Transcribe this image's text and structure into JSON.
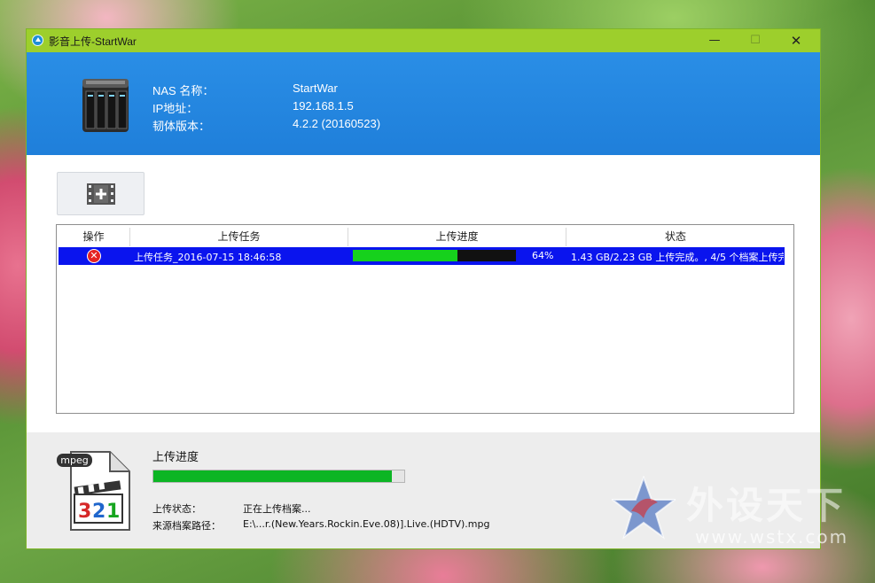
{
  "window": {
    "title": "影音上传-StartWar",
    "controls": {
      "minimize": "—",
      "maximize": "☐",
      "close": "✕"
    }
  },
  "header": {
    "labels": [
      "NAS 名称：",
      "IP地址：",
      "韧体版本："
    ],
    "values": [
      "StartWar",
      "192.168.1.5",
      "4.2.2 (20160523)"
    ]
  },
  "toolbar": {
    "add_button_icon": "film-add-icon"
  },
  "table": {
    "columns": [
      "操作",
      "上传任务",
      "上传进度",
      "状态"
    ],
    "rows": [
      {
        "action_icon": "cancel-icon",
        "task": "上传任务_2016-07-15 18:46:58",
        "progress": 64,
        "progress_label": "64%",
        "status": "1.43 GB/2.23 GB 上传完成。, 4/5 个档案上传完"
      }
    ],
    "selection_color": "#0a14ee"
  },
  "footer": {
    "file_badge": "mpeg",
    "file_digits": "321",
    "progress_title": "上传进度",
    "progress": 0.95,
    "status_label": "上传状态：",
    "status_value": "正在上传档案...",
    "source_label": "来源档案路径：",
    "source_value": "E:\\...r.(New.Years.Rockin.Eve.08)].Live.(HDTV).mpg"
  },
  "watermark": {
    "text": "外设天下",
    "url": "www.wstx.com"
  },
  "colors": {
    "titlebar": "#9dcf2c",
    "header": "#1f7fda",
    "progress_green": "#16d11c"
  }
}
